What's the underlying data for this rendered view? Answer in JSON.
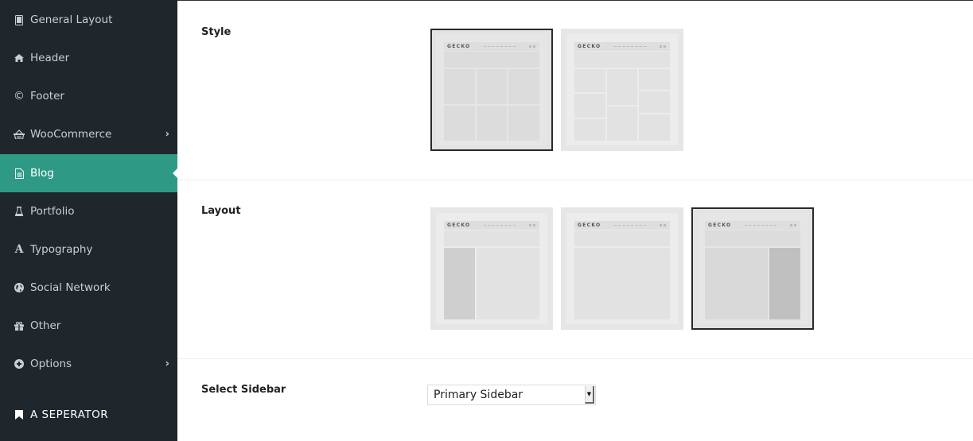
{
  "sidebar": {
    "items": [
      {
        "label": "General Layout",
        "icon": "tablet-icon"
      },
      {
        "label": "Header",
        "icon": "home-icon"
      },
      {
        "label": "Footer",
        "icon": "copyright-icon"
      },
      {
        "label": "WooCommerce",
        "icon": "basket-icon",
        "has_submenu": true
      },
      {
        "label": "Blog",
        "icon": "document-icon",
        "active": true
      },
      {
        "label": "Portfolio",
        "icon": "flask-icon"
      },
      {
        "label": "Typography",
        "icon": "font-icon"
      },
      {
        "label": "Social Network",
        "icon": "globe-icon"
      },
      {
        "label": "Other",
        "icon": "gift-icon"
      },
      {
        "label": "Options",
        "icon": "plus-circle-icon",
        "has_submenu": true
      }
    ],
    "separator": {
      "label": "A SEPERATOR",
      "icon": "bookmark-icon"
    },
    "active_color": "#2e9a86",
    "background": "#1f262c"
  },
  "main": {
    "style": {
      "label": "Style",
      "options": [
        {
          "name": "grid-style",
          "logo": "GECKO",
          "selected": true
        },
        {
          "name": "masonry-style",
          "logo": "GECKO",
          "selected": false
        }
      ]
    },
    "layout": {
      "label": "Layout",
      "options": [
        {
          "name": "left-sidebar",
          "logo": "GECKO",
          "selected": false
        },
        {
          "name": "no-sidebar",
          "logo": "GECKO",
          "selected": false
        },
        {
          "name": "right-sidebar",
          "logo": "GECKO",
          "selected": true
        }
      ]
    },
    "select_sidebar": {
      "label": "Select Sidebar",
      "value": "Primary Sidebar",
      "arrow": "▼"
    }
  }
}
